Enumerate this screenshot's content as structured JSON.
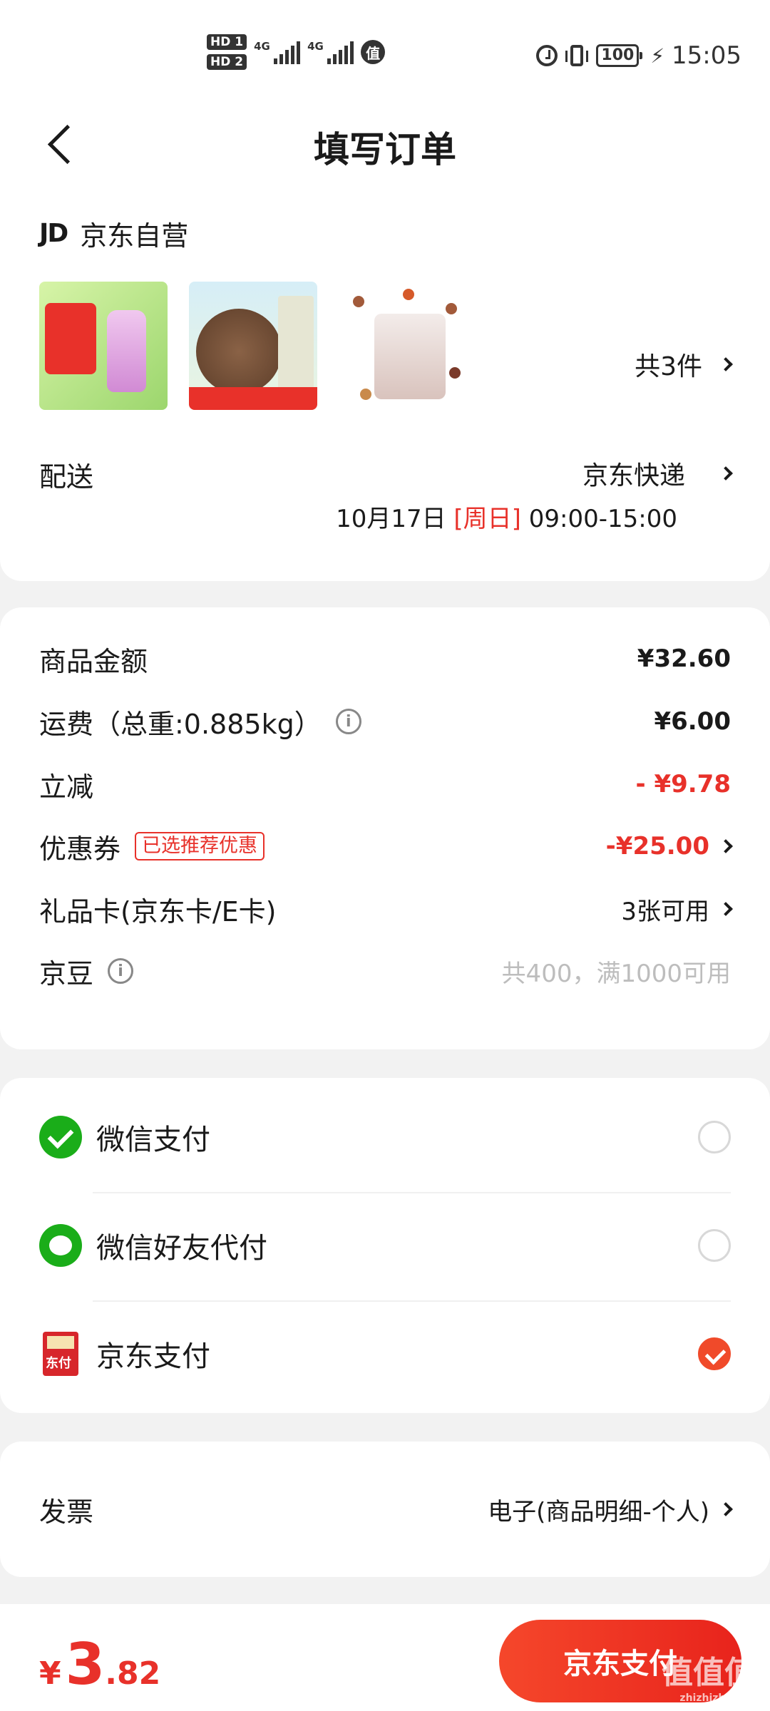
{
  "status_bar": {
    "hd1": "HD 1",
    "hd2": "HD 2",
    "net1": "4G",
    "net2": "4G",
    "app_icon": "值",
    "battery": "100",
    "time": "15:05"
  },
  "header": {
    "title": "填写订单"
  },
  "shop": {
    "logo": "JD",
    "name": "京东自营"
  },
  "products": {
    "count_label": "共3件"
  },
  "delivery": {
    "label": "配送",
    "method": "京东快递",
    "date": "10月17日",
    "weekday": "[周日]",
    "time": "09:00-15:00"
  },
  "price": {
    "goods_label": "商品金额",
    "goods_value": "¥32.60",
    "shipping_label": "运费（总重:0.885kg）",
    "shipping_value": "¥6.00",
    "discount_label": "立减",
    "discount_value": "- ¥9.78",
    "coupon_label": "优惠券",
    "coupon_tag": "已选推荐优惠",
    "coupon_value": "-¥25.00",
    "giftcard_label": "礼品卡(京东卡/E卡)",
    "giftcard_value": "3张可用",
    "jingdou_label": "京豆",
    "jingdou_value": "共400，满1000可用"
  },
  "payment": {
    "options": [
      {
        "label": "微信支付",
        "icon": "wechat-pay-icon",
        "selected": false
      },
      {
        "label": "微信好友代付",
        "icon": "wechat-friend-pay-icon",
        "selected": false
      },
      {
        "label": "京东支付",
        "icon": "jd-pay-icon",
        "selected": true
      }
    ]
  },
  "invoice": {
    "label": "发票",
    "value": "电子(商品明细-个人)"
  },
  "footer": {
    "currency": "¥",
    "total_int": "3",
    "total_dec": ".82",
    "submit_label": "京东支付",
    "watermark": "值值值",
    "watermark_url": "zhizhizhi.com"
  },
  "colors": {
    "accent": "#e8312a",
    "wechat": "#1aad19"
  }
}
